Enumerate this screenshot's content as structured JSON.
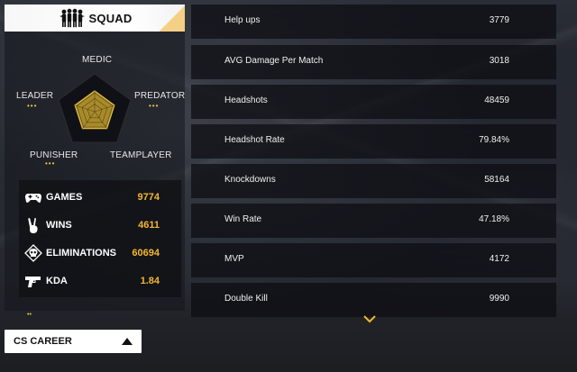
{
  "mode_tab": {
    "label": "SQUAD",
    "icon": "squad-silhouette-icon"
  },
  "radar": {
    "labels": {
      "top": "MEDIC",
      "left": "LEADER",
      "right": "PREDATOR",
      "bottom_left": "PUNISHER",
      "bottom_right": "TEAMPLAYER"
    },
    "levels": {
      "medic": 0.55,
      "predator": 0.55,
      "teamplayer": 0.55,
      "punisher": 0.55,
      "leader": 0.55
    },
    "fill_color": "#a88a2a",
    "stroke_color": "#f0c84a"
  },
  "summary_stats": [
    {
      "icon": "gamepad-icon",
      "label": "GAMES",
      "value": "9774"
    },
    {
      "icon": "victory-hand-icon",
      "label": "WINS",
      "value": "4611"
    },
    {
      "icon": "skull-icon",
      "label": "ELIMINATIONS",
      "value": "60694"
    },
    {
      "icon": "pistol-icon",
      "label": "KDA",
      "value": "1.84"
    }
  ],
  "detail_stats": [
    {
      "label": "Help ups",
      "value": "3779"
    },
    {
      "label": "AVG Damage Per Match",
      "value": "3018"
    },
    {
      "label": "Headshots",
      "value": "48459"
    },
    {
      "label": "Headshot Rate",
      "value": "79.84%"
    },
    {
      "label": "Knockdowns",
      "value": "58164"
    },
    {
      "label": "Win Rate",
      "value": "47.18%"
    },
    {
      "label": "MVP",
      "value": "4172"
    },
    {
      "label": "Double Kill",
      "value": "9990"
    }
  ],
  "career_button": {
    "label": "CS CAREER"
  },
  "colors": {
    "accent": "#f5b630",
    "panel": "#0c0d12"
  }
}
